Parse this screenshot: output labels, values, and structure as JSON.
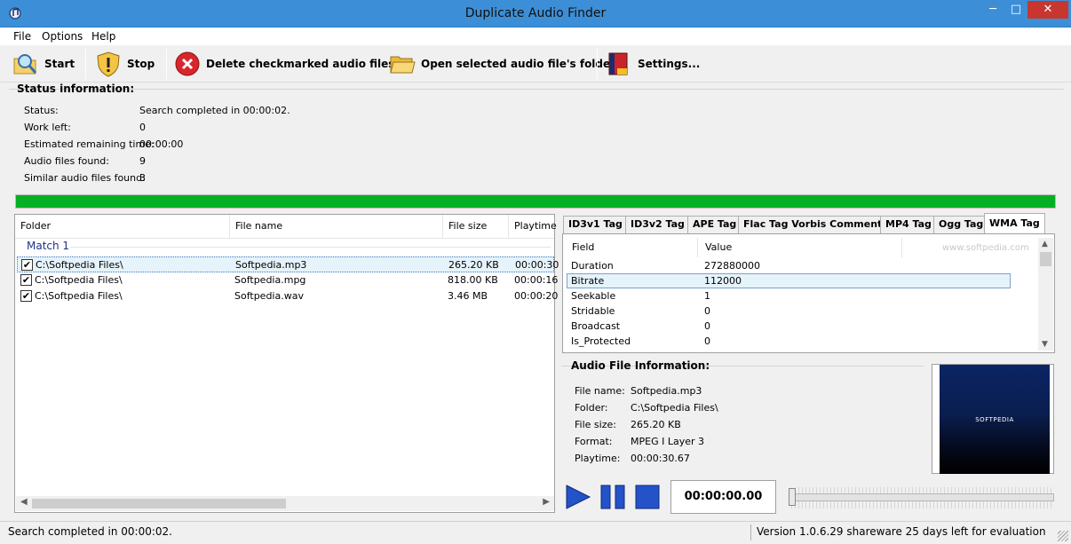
{
  "window": {
    "title": "Duplicate Audio Finder",
    "minimize_symbol": "─",
    "maximize_symbol": "□",
    "close_symbol": "✕"
  },
  "menu": {
    "file": "File",
    "options": "Options",
    "help": "Help"
  },
  "toolbar": {
    "start": "Start",
    "stop": "Stop",
    "delete": "Delete checkmarked audio files...",
    "open_folder": "Open selected audio file's folder",
    "settings": "Settings..."
  },
  "status_info": {
    "heading": "Status information:",
    "labels": [
      "Status:",
      "Work left:",
      "Estimated remaining time:",
      "Audio files found:",
      "Similar audio files found:"
    ],
    "values": [
      "Search completed in 00:00:02.",
      "0",
      "00:00:00",
      "9",
      "3"
    ],
    "progress_percent": 100,
    "progress_color": "#06b025"
  },
  "file_list": {
    "columns": [
      "Folder",
      "File name",
      "File size",
      "Playtime"
    ],
    "group": "Match 1",
    "check_symbol": "✔",
    "rows": [
      {
        "folder": "C:\\Softpedia Files\\",
        "name": "Softpedia.mp3",
        "size": "265.20 KB",
        "playtime": "00:00:30"
      },
      {
        "folder": "C:\\Softpedia Files\\",
        "name": "Softpedia.mpg",
        "size": "818.00 KB",
        "playtime": "00:00:16"
      },
      {
        "folder": "C:\\Softpedia Files\\",
        "name": "Softpedia.wav",
        "size": "3.46 MB",
        "playtime": "00:00:20"
      }
    ],
    "scroll_left": "◀",
    "scroll_right": "▶"
  },
  "tabs": [
    "ID3v1 Tag",
    "ID3v2 Tag",
    "APE Tag",
    "Flac Tag Vorbis Comments",
    "MP4 Tag",
    "Ogg Tag",
    "WMA Tag"
  ],
  "tag_table": {
    "columns": [
      "Field",
      "Value"
    ],
    "watermark": "www.softpedia.com",
    "rows": [
      {
        "field": "Duration",
        "value": "272880000"
      },
      {
        "field": "Bitrate",
        "value": "112000"
      },
      {
        "field": "Seekable",
        "value": "1"
      },
      {
        "field": "Stridable",
        "value": "0"
      },
      {
        "field": "Broadcast",
        "value": "0"
      },
      {
        "field": "Is_Protected",
        "value": "0"
      }
    ],
    "scroll_up": "▲",
    "scroll_down": "▼"
  },
  "audio_info": {
    "heading": "Audio File Information:",
    "labels": [
      "File name:",
      "Folder:",
      "File size:",
      "Format:",
      "Playtime:"
    ],
    "values": [
      "Softpedia.mp3",
      "C:\\Softpedia Files\\",
      "265.20 KB",
      "MPEG I Layer 3",
      "00:00:30.67"
    ],
    "cover_text": "SOFTPEDIA"
  },
  "player": {
    "time": "00:00:00.00",
    "accent": "#2452c8"
  },
  "statusbar": {
    "left": "Search completed in 00:00:02.",
    "right": "Version 1.0.6.29 shareware 25 days left for evaluation"
  }
}
